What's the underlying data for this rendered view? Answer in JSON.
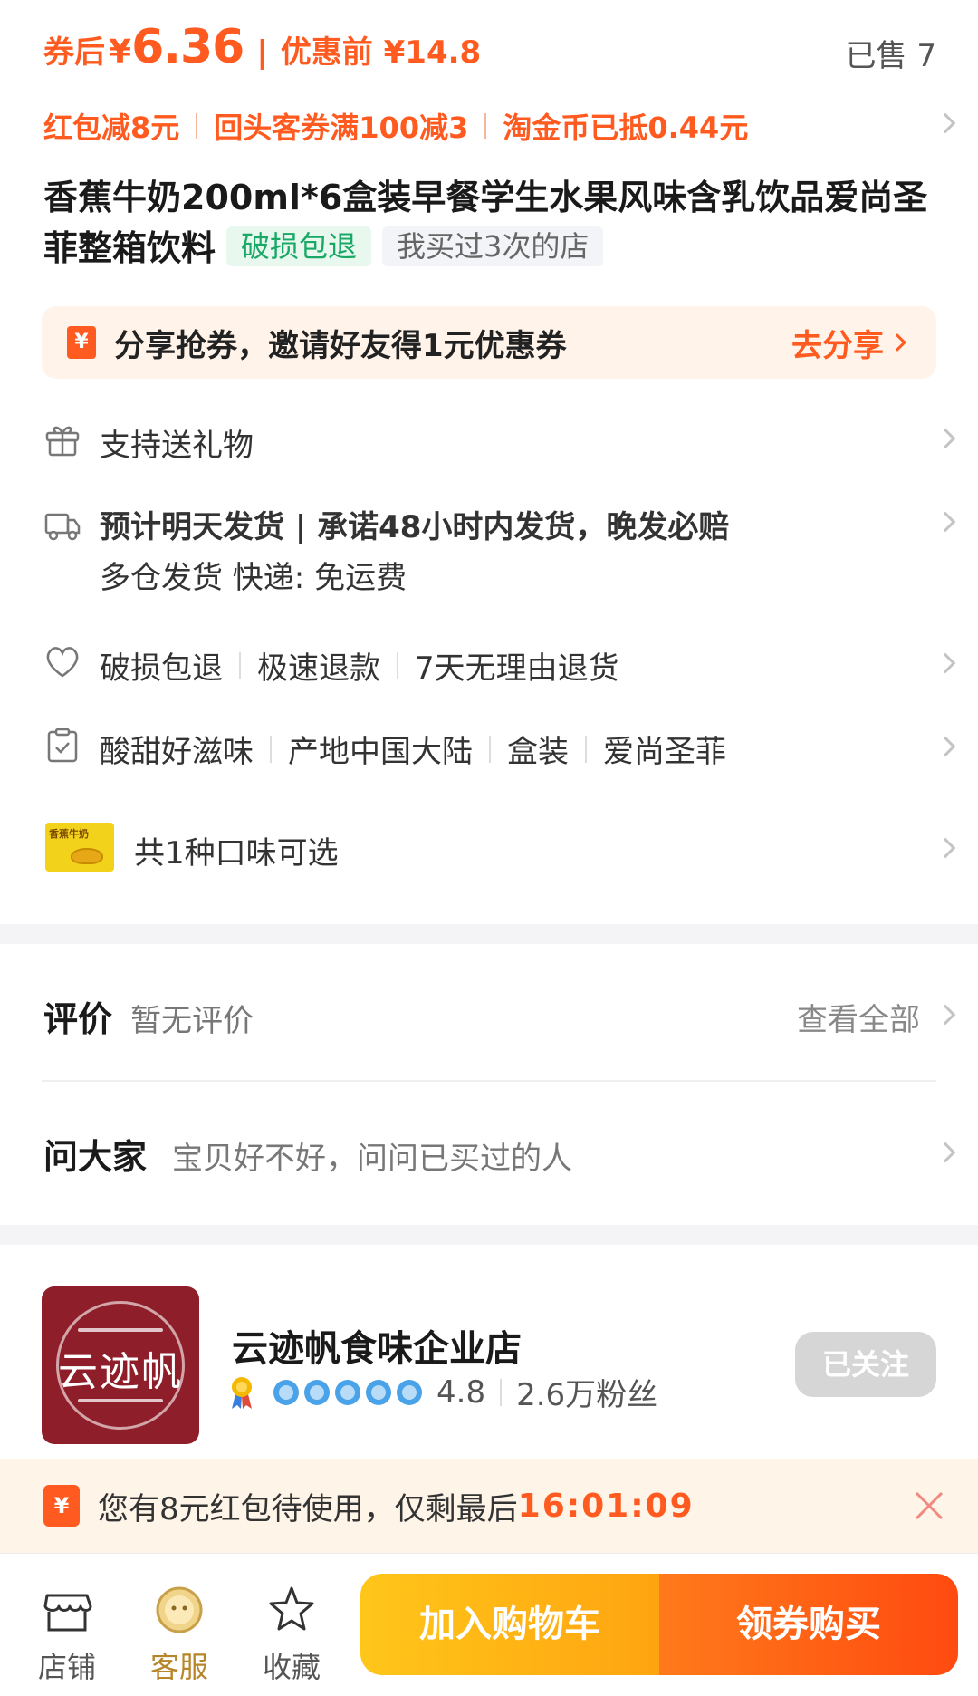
{
  "price": {
    "after_coupon_label": "券后",
    "currency": "¥",
    "after_coupon_value": "6.36",
    "separator": "|",
    "before_label": "优惠前 ¥14.8",
    "sold": "已售 7"
  },
  "promos": [
    "红包减8元",
    "回头客券满100减3",
    "淘金币已抵0.44元"
  ],
  "product": {
    "title": "香蕉牛奶200ml*6盒装早餐学生水果风味含乳饮品爱尚圣菲整箱饮料",
    "tag_damage": "破损包退",
    "tag_bought": "我买过3次的店"
  },
  "share": {
    "icon_text": "¥",
    "text": "分享抢券，邀请好友得1元优惠券",
    "action": "去分享"
  },
  "gift": {
    "text": "支持送礼物"
  },
  "shipping": {
    "line1": "预计明天发货 | 承诺48小时内发货，晚发必赔",
    "line2": "多仓发货  快递: 免运费"
  },
  "guarantee": [
    "破损包退",
    "极速退款",
    "7天无理由退货"
  ],
  "attributes": [
    "酸甜好滋味",
    "产地中国大陆",
    "盒装",
    "爱尚圣菲"
  ],
  "flavor": {
    "thumb_text": "香蕉牛奶",
    "text": "共1种口味可选"
  },
  "reviews": {
    "title": "评价",
    "sub": "暂无评价",
    "view_all": "查看全部"
  },
  "ask": {
    "title": "问大家",
    "sub": "宝贝好不好，问问已买过的人"
  },
  "shop": {
    "logo_text": "云迹帆",
    "name": "云迹帆食味企业店",
    "rating": "4.8",
    "fans": "2.6万粉丝",
    "follow": "已关注",
    "crowns": 5
  },
  "redpack": {
    "icon_text": "¥",
    "text": "您有8元红包待使用，仅剩最后",
    "timer": "16:01:09"
  },
  "bottom": {
    "store": "店铺",
    "service": "客服",
    "favorite": "收藏",
    "add_cart": "加入购物车",
    "buy": "领券购买"
  },
  "colors": {
    "accent": "#ff5a1f",
    "green": "#19a866"
  }
}
